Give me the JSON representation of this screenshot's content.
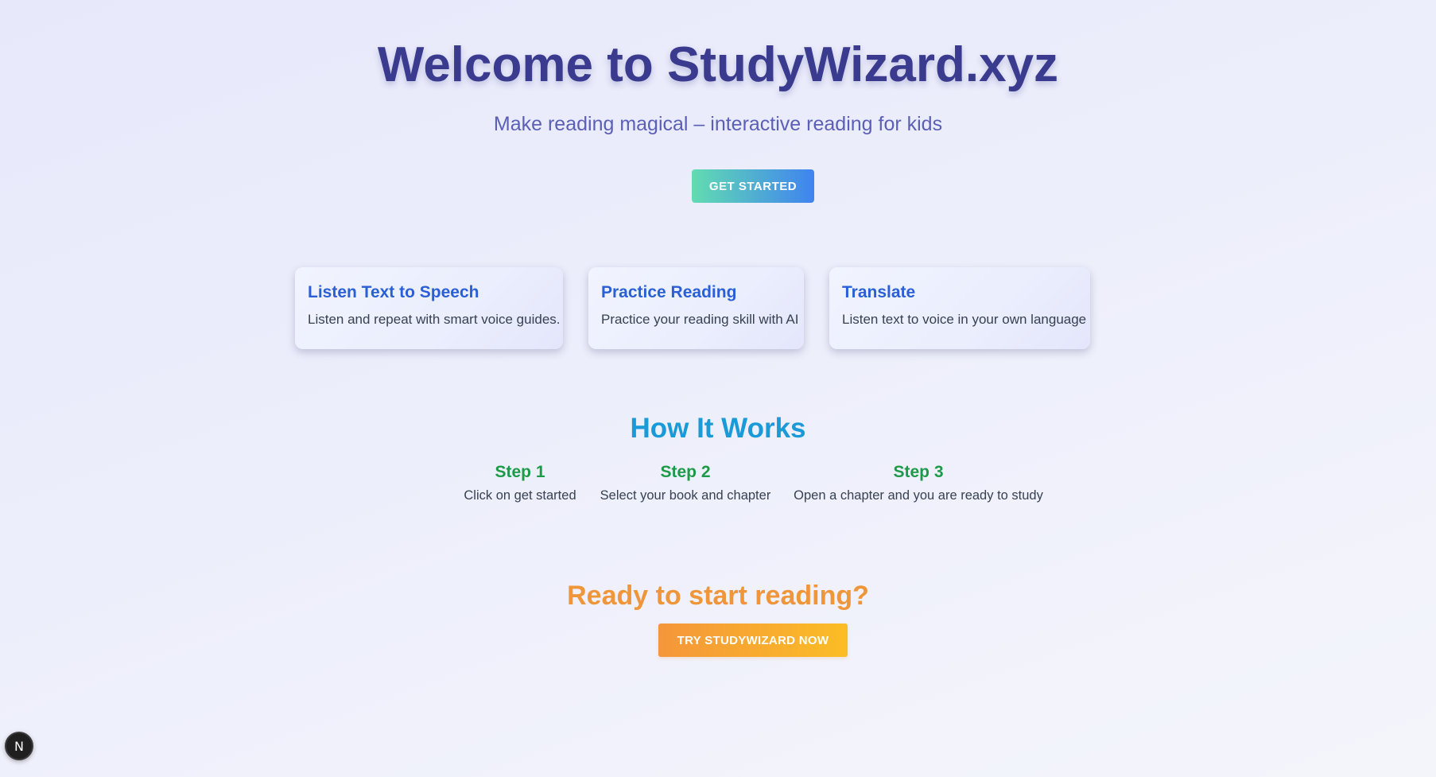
{
  "hero": {
    "title": "Welcome to StudyWizard.xyz",
    "subtitle": "Make reading magical – interactive reading for kids",
    "cta_label": "GET STARTED"
  },
  "features": [
    {
      "title": "Listen Text to Speech",
      "description": "Listen and repeat with smart voice guides."
    },
    {
      "title": "Practice Reading",
      "description": "Practice your reading skill with AI"
    },
    {
      "title": "Translate",
      "description": "Listen text to voice in your own language"
    }
  ],
  "how_it_works": {
    "title": "How It Works",
    "steps": [
      {
        "title": "Step 1",
        "description": "Click on get started"
      },
      {
        "title": "Step 2",
        "description": "Select your book and chapter"
      },
      {
        "title": "Step 3",
        "description": "Open a chapter and you are ready to study"
      }
    ]
  },
  "cta": {
    "title": "Ready to start reading?",
    "button_label": "TRY STUDYWIZARD NOW"
  },
  "dev_badge": {
    "icon": "nextjs-logo-icon",
    "glyph": "N"
  },
  "colors": {
    "title": "#3a3b8f",
    "subtitle": "#5b5fb5",
    "feature_title": "#2a5fd6",
    "how_title": "#1a9ad6",
    "step_title": "#1d9a48",
    "cta_title": "#f0963a"
  }
}
